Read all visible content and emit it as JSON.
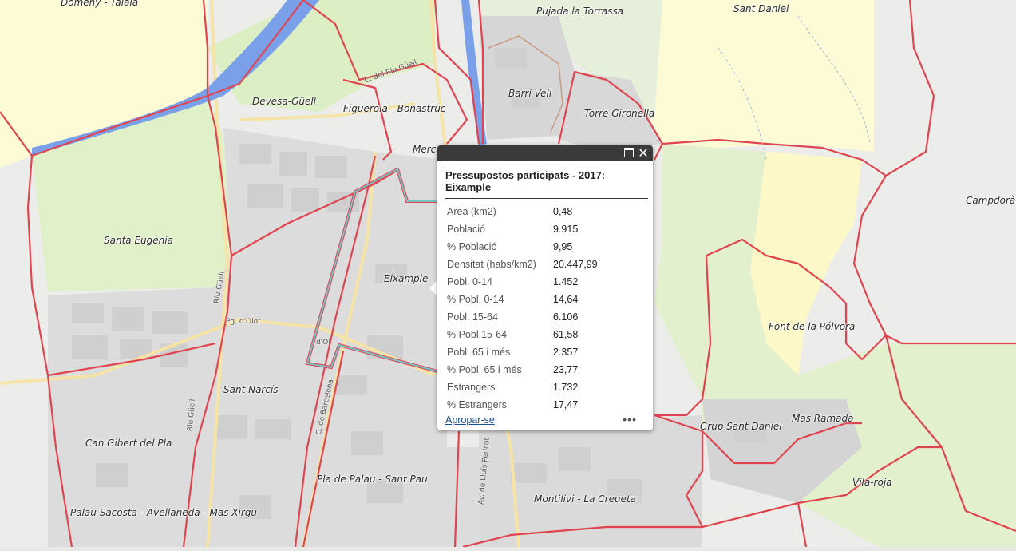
{
  "map": {
    "places": [
      {
        "id": "domeny-taiala",
        "name": "Domeny - Taialà"
      },
      {
        "id": "pujada-torrassa",
        "name": "Pujada la Torrassa"
      },
      {
        "id": "sant-daniel",
        "name": "Sant Daniel"
      },
      {
        "id": "devesa-guell",
        "name": "Devesa-Güell"
      },
      {
        "id": "figuerola",
        "name": "Figuerola - Bonastruc"
      },
      {
        "id": "barri-vell",
        "name": "Barri Vell"
      },
      {
        "id": "torre-gironella",
        "name": "Torre Gironella"
      },
      {
        "id": "mercadal",
        "name": "Merca"
      },
      {
        "id": "campdora",
        "name": "Campdorà -"
      },
      {
        "id": "santa-eugenia",
        "name": "Santa Eugènia"
      },
      {
        "id": "eixample",
        "name": "Eixample"
      },
      {
        "id": "font-polvora",
        "name": "Font de la Pólvora"
      },
      {
        "id": "sant-narcis",
        "name": "Sant Narcís"
      },
      {
        "id": "grup-sant-daniel",
        "name": "Grup Sant Daniel"
      },
      {
        "id": "mas-ramada",
        "name": "Mas Ramada"
      },
      {
        "id": "can-gibert",
        "name": "Can Gibert del Pla"
      },
      {
        "id": "pla-palau",
        "name": "Pla de Palau - Sant Pau"
      },
      {
        "id": "vila-roja",
        "name": "Vila-roja"
      },
      {
        "id": "montilivi",
        "name": "Montilivi - La Creueta"
      },
      {
        "id": "palau-sacosta",
        "name": "Palau Sacosta - Avellaneda - Mas Xirgu"
      }
    ],
    "streets": [
      {
        "id": "riu-guell-1",
        "name": "C. del Riu Güell"
      },
      {
        "id": "pg-olot",
        "name": "Pg. d'Olot"
      },
      {
        "id": "barcelona",
        "name": "C. de Barcelona"
      },
      {
        "id": "lluis-pericot",
        "name": "Av. de Lluís Pericot"
      },
      {
        "id": "riu-guell-2",
        "name": "Riu Güell"
      },
      {
        "id": "riu-guell-3",
        "name": "Riu Güell"
      },
      {
        "id": "olot-2",
        "name": "d'Ol"
      }
    ]
  },
  "popup": {
    "title": "Pressupostos participats - 2017: Eixample",
    "rows": [
      {
        "label": "Area (km2)",
        "value": "0,48"
      },
      {
        "label": "Població",
        "value": "9.915"
      },
      {
        "label": "% Població",
        "value": "9,95"
      },
      {
        "label": "Densitat (habs/km2)",
        "value": "20.447,99"
      },
      {
        "label": "Pobl. 0-14",
        "value": "1.452"
      },
      {
        "label": "% Pobl. 0-14",
        "value": "14,64"
      },
      {
        "label": "Pobl. 15-64",
        "value": "6.106"
      },
      {
        "label": "% Pobl.15-64",
        "value": "61,58"
      },
      {
        "label": "Pobl. 65 i més",
        "value": "2.357"
      },
      {
        "label": "% Pobl. 65 i més",
        "value": "23,77"
      },
      {
        "label": "Estrangers",
        "value": "1.732"
      },
      {
        "label": "% Estrangers",
        "value": "17,47"
      }
    ],
    "zoom_label": "Apropar-se",
    "more_label": "•••"
  },
  "colors": {
    "boundary": "#e0454f",
    "selected": "#6fb7bb",
    "river": "#6f8fe0",
    "green": "#dff0c9",
    "yellow": "#fdfbd2"
  }
}
